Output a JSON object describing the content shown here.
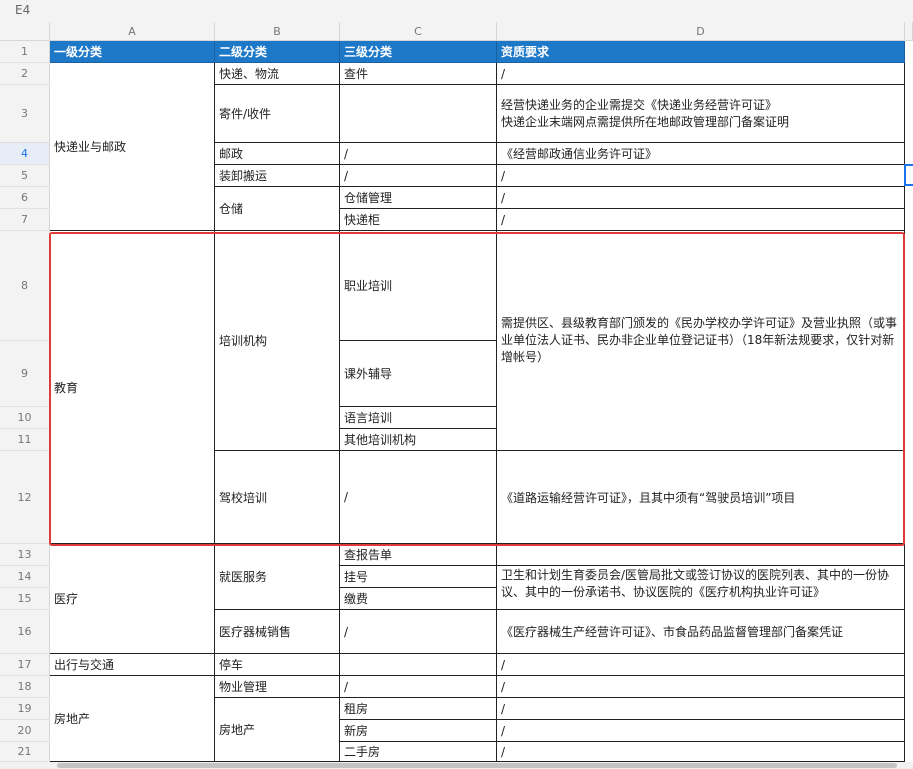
{
  "name_box": "E4",
  "columns": [
    "A",
    "B",
    "C",
    "D"
  ],
  "rows": [
    "1",
    "2",
    "3",
    "4",
    "5",
    "6",
    "7",
    "8",
    "9",
    "10",
    "11",
    "12",
    "13",
    "14",
    "15",
    "16",
    "17",
    "18",
    "19",
    "20",
    "21"
  ],
  "header": {
    "a": "一级分类",
    "b": "二级分类",
    "c": "三级分类",
    "d": "资质要求"
  },
  "cells": {
    "a_express": "快递业与邮政",
    "a_edu": "教育",
    "a_medical": "医疗",
    "a_travel": "出行与交通",
    "a_estate": "房地产",
    "b2": "快递、物流",
    "b3": "寄件/收件",
    "b4": "邮政",
    "b5": "装卸搬运",
    "b_storage": "仓储",
    "b_training": "培训机构",
    "b12": "驾校培训",
    "b_medservice": "就医服务",
    "b16": "医疗器械销售",
    "b17": "停车",
    "b18": "物业管理",
    "b_estate": "房地产",
    "c2": "查件",
    "c4": "/",
    "c5": "/",
    "c6": "仓储管理",
    "c7": "快递柜",
    "c8": "职业培训",
    "c9": "课外辅导",
    "c10": "语言培训",
    "c11": "其他培训机构",
    "c12": "/",
    "c13": "查报告单",
    "c14": "挂号",
    "c15": "缴费",
    "c16": "/",
    "c18": "/",
    "c19": "租房",
    "c20": "新房",
    "c21": "二手房",
    "d2": "/",
    "d3": "经营快递业务的企业需提交《快递业务经营许可证》\n快递企业末端网点需提供所在地邮政管理部门备案证明",
    "d4": "《经营邮政通信业务许可证》",
    "d5": "/",
    "d6": "/",
    "d7": "/",
    "d_training": "需提供区、县级教育部门颁发的《民办学校办学许可证》及营业执照（或事业单位法人证书、民办非企业单位登记证书）（18年新法规要求，仅针对新增帐号）",
    "d12": "《道路运输经营许可证》，且其中须有“驾驶员培训”项目",
    "d_med": "卫生和计划生育委员会/医管局批文或签订协议的医院列表、其中的一份协议、其中的一份承诺书、协议医院的《医疗机构执业许可证》",
    "d16": "《医疗器械生产经营许可证》、市食品药品监督管理部门备案凭证",
    "d17": "/",
    "d18": "/",
    "d19": "/",
    "d20": "/",
    "d21": "/"
  },
  "colors": {
    "header_bg": "#1e78c8",
    "highlight_border": "#e03b3b",
    "selection": "#1a73e8"
  }
}
